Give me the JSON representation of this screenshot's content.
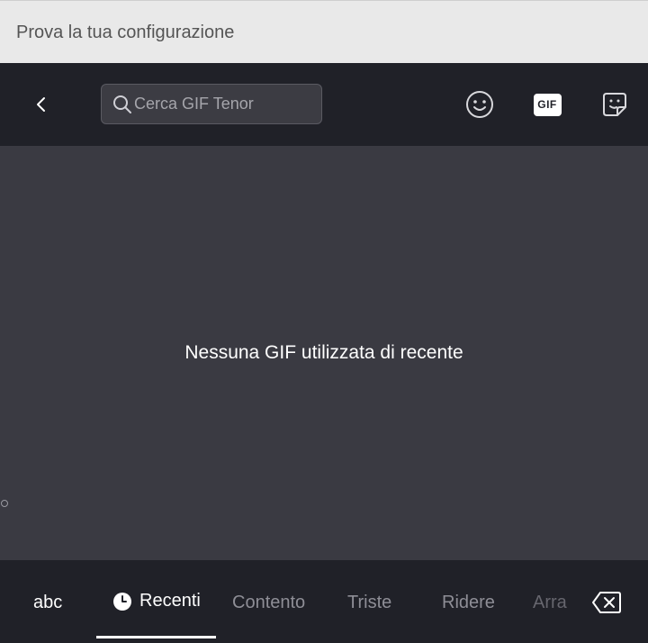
{
  "input_field": {
    "text": "Prova la tua configurazione"
  },
  "toolbar": {
    "back_icon": "chevron-left-icon",
    "search_placeholder": "Cerca GIF Tenor",
    "emoji_icon": "smiley-icon",
    "gif_label": "GIF",
    "sticker_icon": "sticker-icon"
  },
  "content": {
    "empty_message": "Nessuna GIF utilizzata di recente"
  },
  "categories": {
    "abc": "abc",
    "items": [
      "Recenti",
      "Contento",
      "Triste",
      "Ridere",
      "Arra"
    ],
    "selected": "Recenti",
    "delete_icon": "backspace-icon"
  },
  "colors": {
    "toolbar_bg": "#202128",
    "content_bg": "#3a3a42",
    "input_bg": "#e9e9e9",
    "active": "#ffffff",
    "inactive": "#8e8e96"
  }
}
